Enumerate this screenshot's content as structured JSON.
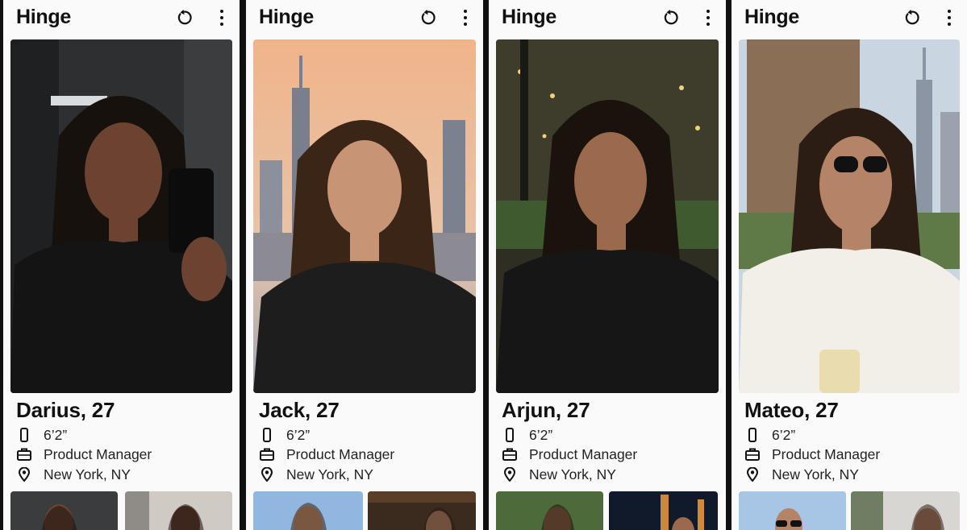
{
  "profiles": [
    {
      "app_title": "Hinge",
      "name": "Darius, 27",
      "height": "6’2”",
      "job": "Product Manager",
      "location": "New York, NY",
      "colors": {
        "bg": "#2d2f31",
        "bg2": "#4a4c4e",
        "skin": "#6b4330",
        "hair": "#17110d",
        "shirt": "#141414"
      }
    },
    {
      "app_title": "Hinge",
      "name": "Jack, 27",
      "height": "6’2”",
      "job": "Product Manager",
      "location": "New York, NY",
      "colors": {
        "bg": "#e8b48c",
        "bg2": "#8a8fa3",
        "skin": "#c89476",
        "hair": "#3a2516",
        "shirt": "#1d1d1d"
      }
    },
    {
      "app_title": "Hinge",
      "name": "Arjun, 27",
      "height": "6’2”",
      "job": "Product Manager",
      "location": "New York, NY",
      "colors": {
        "bg": "#3b3a28",
        "bg2": "#6a5a2e",
        "skin": "#9b6a4c",
        "hair": "#1a120c",
        "shirt": "#161616"
      }
    },
    {
      "app_title": "Hinge",
      "name": "Mateo, 27",
      "height": "6’2”",
      "job": "Product Manager",
      "location": "New York, NY",
      "colors": {
        "bg": "#b9c9d8",
        "bg2": "#8a6e55",
        "skin": "#b58366",
        "hair": "#2b1d14",
        "shirt": "#f2efe9"
      }
    }
  ]
}
